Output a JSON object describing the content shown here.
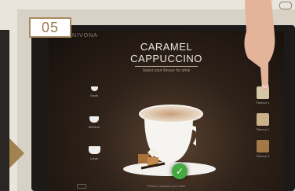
{
  "step": {
    "number": "05"
  },
  "screen": {
    "brand": "NIVONA",
    "title_line1": "CARAMEL",
    "title_line2": "CAPPUCCINO",
    "subtitle": "Select your flavour for drink"
  },
  "sizes": [
    {
      "label": "Small"
    },
    {
      "label": "Medium"
    },
    {
      "label": "Large"
    }
  ],
  "flavours": [
    {
      "label": "Flavour 1",
      "color": "#d6c7a8"
    },
    {
      "label": "Flavour 2",
      "color": "#cbb28a"
    },
    {
      "label": "Flavour 3",
      "color": "#a37848"
    }
  ],
  "confirm": {
    "icon": "checkmark-icon",
    "caption": "Press to prepare your drink",
    "color": "#44a93f"
  },
  "colors": {
    "accent": "#a2824f",
    "screen_bg": "#160f0b"
  }
}
